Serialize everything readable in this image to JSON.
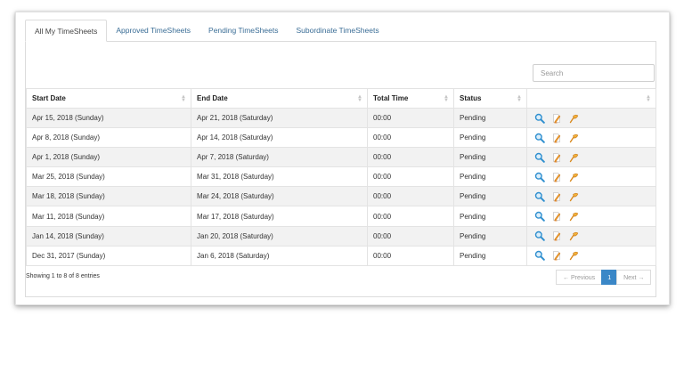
{
  "tabs": [
    {
      "label": "All My TimeSheets",
      "active": true
    },
    {
      "label": "Approved TimeSheets",
      "active": false
    },
    {
      "label": "Pending TimeSheets",
      "active": false
    },
    {
      "label": "Subordinate TimeSheets",
      "active": false
    }
  ],
  "search": {
    "placeholder": "Search",
    "value": ""
  },
  "table": {
    "columns": [
      "Start Date",
      "End Date",
      "Total Time",
      "Status",
      ""
    ],
    "rows": [
      {
        "start": "Apr 15, 2018 (Sunday)",
        "end": "Apr 21, 2018 (Saturday)",
        "total": "00:00",
        "status": "Pending"
      },
      {
        "start": "Apr 8, 2018 (Sunday)",
        "end": "Apr 14, 2018 (Saturday)",
        "total": "00:00",
        "status": "Pending"
      },
      {
        "start": "Apr 1, 2018 (Sunday)",
        "end": "Apr 7, 2018 (Saturday)",
        "total": "00:00",
        "status": "Pending"
      },
      {
        "start": "Mar 25, 2018 (Sunday)",
        "end": "Mar 31, 2018 (Saturday)",
        "total": "00:00",
        "status": "Pending"
      },
      {
        "start": "Mar 18, 2018 (Sunday)",
        "end": "Mar 24, 2018 (Saturday)",
        "total": "00:00",
        "status": "Pending"
      },
      {
        "start": "Mar 11, 2018 (Sunday)",
        "end": "Mar 17, 2018 (Saturday)",
        "total": "00:00",
        "status": "Pending"
      },
      {
        "start": "Jan 14, 2018 (Sunday)",
        "end": "Jan 20, 2018 (Saturday)",
        "total": "00:00",
        "status": "Pending"
      },
      {
        "start": "Dec 31, 2017 (Sunday)",
        "end": "Jan 6, 2018 (Saturday)",
        "total": "00:00",
        "status": "Pending"
      }
    ],
    "row_actions": [
      "view-icon",
      "edit-icon",
      "submit-icon"
    ]
  },
  "footer": {
    "info": "Showing 1 to 8 of 8 entries",
    "previous_label": "← Previous",
    "current_page": "1",
    "next_label": "Next →"
  },
  "colors": {
    "tab_link": "#3a6d96",
    "pager_active": "#3a87c7",
    "striped_row": "#f2f2f2"
  }
}
